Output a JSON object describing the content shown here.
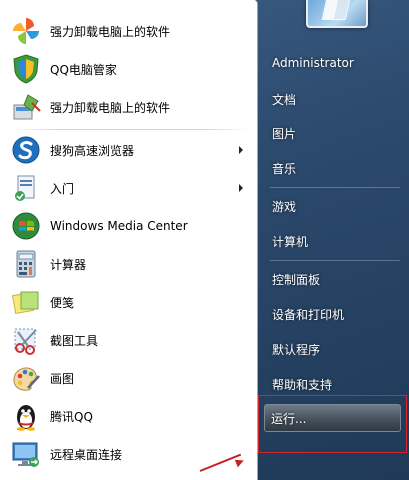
{
  "left_menu": {
    "items": [
      {
        "label": "强力卸载电脑上的软件",
        "icon": "pinwheel-icon",
        "has_arrow": false
      },
      {
        "label": "QQ电脑管家",
        "icon": "shield-icon",
        "has_arrow": false
      },
      {
        "label": "强力卸载电脑上的软件",
        "icon": "uninstall-icon",
        "has_arrow": false
      },
      {
        "label": "搜狗高速浏览器",
        "icon": "sogou-browser-icon",
        "has_arrow": true
      },
      {
        "label": "入门",
        "icon": "getting-started-icon",
        "has_arrow": true
      },
      {
        "label": "Windows Media Center",
        "icon": "media-center-icon",
        "has_arrow": false
      },
      {
        "label": "计算器",
        "icon": "calculator-icon",
        "has_arrow": false
      },
      {
        "label": "便笺",
        "icon": "sticky-notes-icon",
        "has_arrow": false
      },
      {
        "label": "截图工具",
        "icon": "snipping-tool-icon",
        "has_arrow": false
      },
      {
        "label": "画图",
        "icon": "paint-icon",
        "has_arrow": false
      },
      {
        "label": "腾讯QQ",
        "icon": "qq-penguin-icon",
        "has_arrow": false
      },
      {
        "label": "远程桌面连接",
        "icon": "remote-desktop-icon",
        "has_arrow": false
      }
    ]
  },
  "right_menu": {
    "items": [
      {
        "label": "Administrator"
      },
      {
        "label": "文档"
      },
      {
        "label": "图片"
      },
      {
        "label": "音乐"
      },
      {
        "label": "游戏"
      },
      {
        "label": "计算机"
      },
      {
        "label": "控制面板"
      },
      {
        "label": "设备和打印机"
      },
      {
        "label": "默认程序"
      },
      {
        "label": "帮助和支持"
      }
    ],
    "run_label": "运行..."
  },
  "colors": {
    "accent_red": "#d7242a",
    "right_panel": "#2c4a6e"
  }
}
